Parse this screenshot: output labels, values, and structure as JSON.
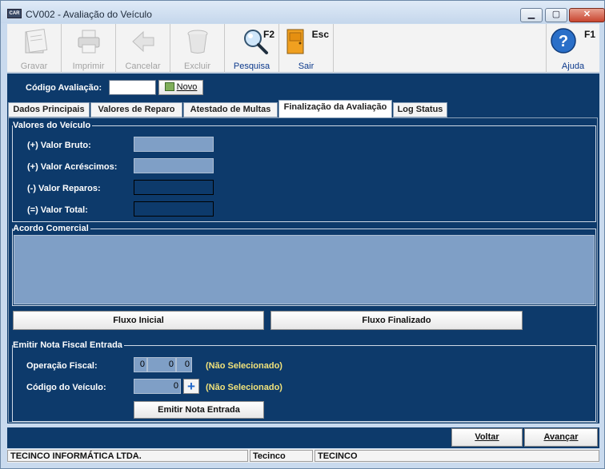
{
  "window": {
    "title": "CV002 - Avaliação do Veículo",
    "app_badge": "CAR"
  },
  "toolbar": {
    "gravar": "Gravar",
    "imprimir": "Imprimir",
    "cancelar": "Cancelar",
    "excluir": "Excluir",
    "pesquisa": "Pesquisa",
    "pesquisa_key": "F2",
    "sair": "Sair",
    "sair_key": "Esc",
    "ajuda": "Ajuda",
    "ajuda_key": "F1"
  },
  "codigo": {
    "label": "Código Avaliação:",
    "value": "",
    "novo": "Novo"
  },
  "tabs": [
    "Dados Principais",
    "Valores de Reparo",
    "Atestado de Multas",
    "Finalização da Avaliação",
    "Log Status"
  ],
  "valores": {
    "title": "Valores do Veículo",
    "bruto": "(+) Valor Bruto:",
    "acrescimos": "(+) Valor Acréscimos:",
    "reparos": "(-) Valor Reparos:",
    "total": "(=) Valor Total:"
  },
  "acordo": {
    "title": "Acordo Comercial",
    "text": ""
  },
  "fluxo": {
    "inicial": "Fluxo Inicial",
    "finalizado": "Fluxo Finalizado"
  },
  "nota": {
    "title": "Emitir Nota Fiscal Entrada",
    "operacao_label": "Operação Fiscal:",
    "operacao_values": [
      "0",
      "0",
      "0"
    ],
    "operacao_status": "(Não Selecionado)",
    "veiculo_label": "Código do Veículo:",
    "veiculo_value": "0",
    "veiculo_status": "(Não Selecionado)",
    "emitir": "Emitir Nota Entrada"
  },
  "nav": {
    "voltar": "Voltar",
    "avancar": "Avançar"
  },
  "status": {
    "company": "TECINCO INFORMÁTICA LTDA.",
    "user": "Tecinco",
    "db": "TECINCO"
  },
  "colors": {
    "panel": "#0d3a6b",
    "field_blue": "#7f9fc6",
    "status_yellow": "#f1e27a"
  }
}
